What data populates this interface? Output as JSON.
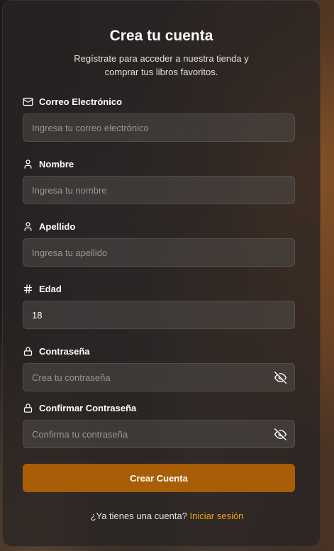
{
  "header": {
    "title": "Crea tu cuenta",
    "subtitle": "Regístrate para acceder a nuestra tienda y comprar tus libros favoritos."
  },
  "fields": {
    "email": {
      "label": "Correo Electrónico",
      "placeholder": "Ingresa tu correo electrónico",
      "icon": "mail-icon"
    },
    "first_name": {
      "label": "Nombre",
      "placeholder": "Ingresa tu nombre",
      "icon": "user-icon"
    },
    "last_name": {
      "label": "Apellido",
      "placeholder": "Ingresa tu apellido",
      "icon": "user-icon"
    },
    "age": {
      "label": "Edad",
      "value": "18",
      "icon": "hash-icon"
    },
    "password": {
      "label": "Contraseña",
      "placeholder": "Crea tu contraseña",
      "icon": "lock-icon"
    },
    "confirm_password": {
      "label": "Confirmar Contraseña",
      "placeholder": "Confirma tu contraseña",
      "icon": "lock-icon"
    }
  },
  "submit_label": "Crear Cuenta",
  "footer": {
    "prompt": "¿Ya tienes una cuenta?",
    "link": "Iniciar sesión"
  },
  "colors": {
    "accent": "#a85e07",
    "link": "#f0a30a"
  }
}
